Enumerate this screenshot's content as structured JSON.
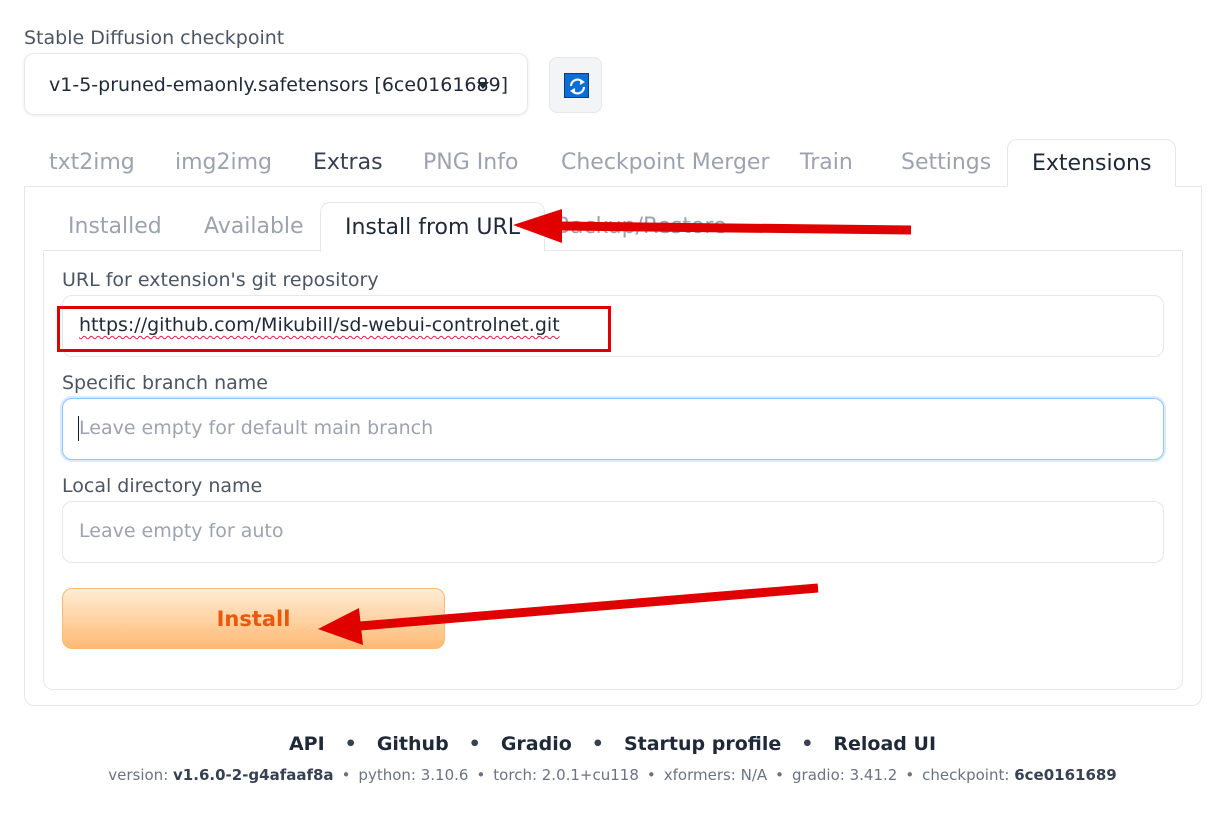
{
  "checkpoint": {
    "label": "Stable Diffusion checkpoint",
    "value": "v1-5-pruned-emaonly.safetensors [6ce0161689]"
  },
  "main_tabs": [
    "txt2img",
    "img2img",
    "Extras",
    "PNG Info",
    "Checkpoint Merger",
    "Train",
    "Settings",
    "Extensions"
  ],
  "sub_tabs": [
    "Installed",
    "Available",
    "Install from URL",
    "Backup/Restore"
  ],
  "form": {
    "url_label": "URL for extension's git repository",
    "url_value": "https://github.com/Mikubill/sd-webui-controlnet.git",
    "branch_label": "Specific branch name",
    "branch_placeholder": "Leave empty for default main branch",
    "dir_label": "Local directory name",
    "dir_placeholder": "Leave empty for auto",
    "install_label": "Install"
  },
  "footer": {
    "links": [
      "API",
      "Github",
      "Gradio",
      "Startup profile",
      "Reload UI"
    ],
    "separator": "•",
    "version_label": "version:",
    "version_value": "v1.6.0-2-g4afaaf8a",
    "python": "python: 3.10.6",
    "torch": "torch: 2.0.1+cu118",
    "xformers": "xformers: N/A",
    "gradio": "gradio: 3.41.2",
    "checkpoint_label": "checkpoint:",
    "checkpoint_value": "6ce0161689"
  },
  "icons": {
    "refresh": "refresh-icon",
    "dropdown": "chevron-down-icon"
  },
  "colors": {
    "annotation_red": "#e00000",
    "install_text": "#ea580c",
    "install_bg_top": "#ffedd5",
    "install_bg_bottom": "#fdba74",
    "refresh_icon_bg": "#0b6fd6"
  }
}
